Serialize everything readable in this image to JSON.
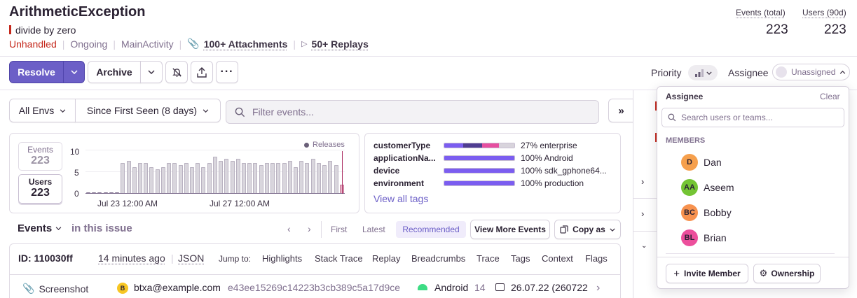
{
  "issue": {
    "title": "ArithmeticException",
    "message": "divide by zero",
    "unhandled": "Unhandled",
    "status": "Ongoing",
    "culprit": "MainActivity",
    "attachments": "100+ Attachments",
    "replays": "50+ Replays"
  },
  "counts": {
    "events_label": "Events (total)",
    "events_value": "223",
    "users_label": "Users (90d)",
    "users_value": "223"
  },
  "toolbar": {
    "resolve": "Resolve",
    "archive": "Archive",
    "priority_label": "Priority",
    "assignee_label": "Assignee",
    "assignee_value": "Unassigned"
  },
  "filters": {
    "env": "All Envs",
    "range": "Since First Seen (8 days)",
    "search_placeholder": "Filter events..."
  },
  "chart_data": {
    "type": "bar",
    "legend": "Releases",
    "yticks": [
      "10",
      "5",
      "0"
    ],
    "xticks": [
      "Jul 23 12:00 AM",
      "Jul 27 12:00 AM"
    ],
    "ylim": [
      0,
      10
    ],
    "values": [
      0,
      0,
      0,
      0,
      0,
      0,
      7,
      7.5,
      6,
      7,
      7,
      6,
      5.5,
      6,
      7,
      7,
      6.5,
      7,
      6,
      7,
      6,
      7,
      8.5,
      7.5,
      8,
      7.5,
      8,
      7,
      7,
      7,
      6.5,
      7,
      7,
      7,
      7,
      7.5,
      6,
      7.5,
      7,
      8,
      7,
      6.5,
      7.5,
      6.5,
      2
    ]
  },
  "stats": {
    "events_label": "Events",
    "events_value": "223",
    "users_label": "Users",
    "users_value": "223"
  },
  "tags": {
    "rows": [
      {
        "name": "customerType",
        "value": "27% enterprise"
      },
      {
        "name": "applicationNa...",
        "value": "100% Android"
      },
      {
        "name": "device",
        "value": "100% sdk_gphone64..."
      },
      {
        "name": "environment",
        "value": "100% production"
      }
    ],
    "view_all": "View all tags",
    "colors": [
      "#7b5df0",
      "#4f3d91",
      "#e64fa0",
      "#d8d4dc"
    ]
  },
  "events": {
    "heading": "Events",
    "scope": "in this issue",
    "first": "First",
    "latest": "Latest",
    "recommended": "Recommended",
    "view_more": "View More Events",
    "copy_as": "Copy as",
    "id": "ID: 110030ff",
    "time": "14 minutes ago",
    "json": "JSON",
    "jump_to": "Jump to:",
    "jumps": [
      "Highlights",
      "Stack Trace",
      "Replay",
      "Breadcrumbs",
      "Trace",
      "Tags",
      "Context",
      "Flags"
    ],
    "screenshot": "Screenshot",
    "user_email": "btxa@example.com",
    "user_hash": "e43ee15269c14223b3cb389c5a17d9ce",
    "os": "Android",
    "os_version": "14",
    "release": "26.07.22 (260722"
  },
  "dropdown": {
    "title": "Assignee",
    "clear": "Clear",
    "search_placeholder": "Search users or teams...",
    "members_heading": "MEMBERS",
    "members": [
      {
        "initials": "D",
        "name": "Dan",
        "color": "#f6a04d"
      },
      {
        "initials": "AA",
        "name": "Aseem",
        "color": "#74c434"
      },
      {
        "initials": "BC",
        "name": "Bobby",
        "color": "#f7924f"
      },
      {
        "initials": "BL",
        "name": "Brian",
        "color": "#ec4f9c"
      }
    ],
    "invite": "Invite Member",
    "ownership": "Ownership"
  },
  "accent": "#6c5fc7"
}
